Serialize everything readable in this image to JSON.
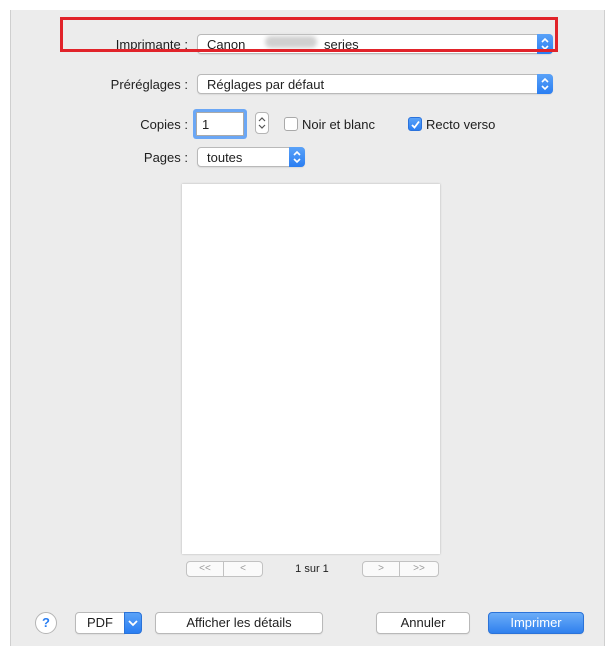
{
  "printer": {
    "label": "Imprimante :",
    "value_prefix": "Canon",
    "value_suffix": "series"
  },
  "presets": {
    "label": "Préréglages :",
    "value": "Réglages par défaut"
  },
  "copies": {
    "label": "Copies :",
    "value": "1"
  },
  "black_white": {
    "label": "Noir et blanc",
    "checked": false
  },
  "duplex": {
    "label": "Recto verso",
    "checked": true
  },
  "pages": {
    "label": "Pages :",
    "value": "toutes"
  },
  "pager": {
    "first": "<<",
    "prev": "<",
    "status": "1 sur 1",
    "next": ">",
    "last": ">>"
  },
  "footer": {
    "help": "?",
    "pdf": "PDF",
    "details": "Afficher les détails",
    "cancel": "Annuler",
    "print": "Imprimer"
  },
  "colors": {
    "accent": "#2a7ef2",
    "highlight": "#e1232a",
    "dialog_bg": "#ececec"
  }
}
